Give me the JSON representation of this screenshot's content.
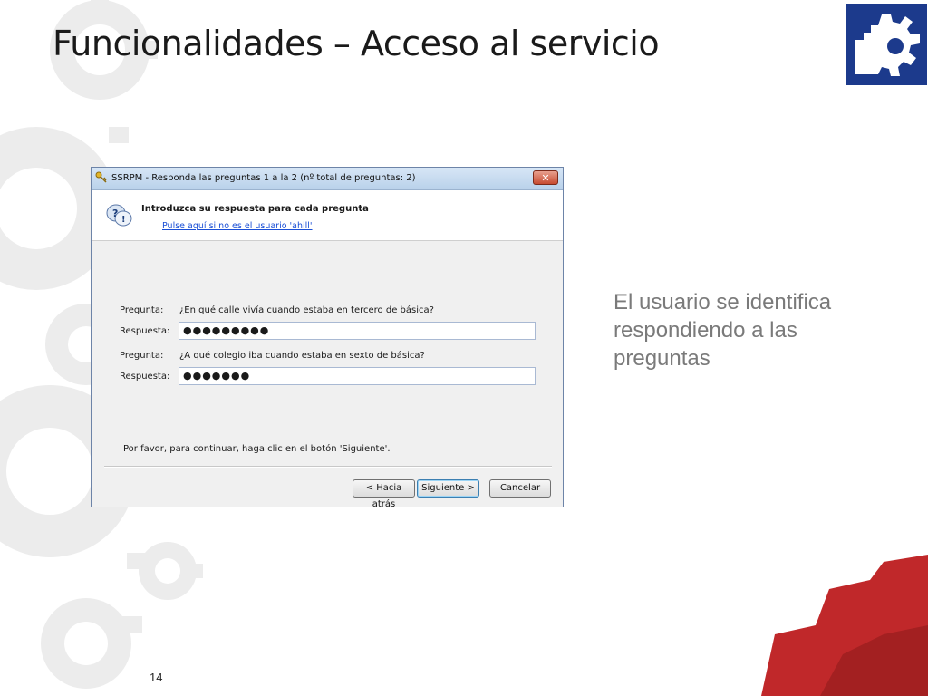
{
  "slide": {
    "title": "Funcionalidades – Acceso al servicio",
    "side_text": "El usuario se identifica respondiendo a las preguntas",
    "page_number": "14"
  },
  "dialog": {
    "title": "SSRPM - Responda las preguntas 1 a la 2 (nº total de preguntas: 2)",
    "close_label": "✕",
    "header_title": "Introduzca su respuesta para cada pregunta",
    "header_link": "Pulse aquí si no es el usuario 'ahill'",
    "questions": [
      {
        "question_label": "Pregunta:",
        "question_text": "¿En qué calle vivía cuando estaba en tercero de básica?",
        "answer_label": "Respuesta:",
        "answer_value": "●●●●●●●●●"
      },
      {
        "question_label": "Pregunta:",
        "question_text": "¿A qué colegio iba cuando estaba en sexto de básica?",
        "answer_label": "Respuesta:",
        "answer_value": "●●●●●●●"
      }
    ],
    "footer_text": "Por favor, para continuar, haga clic en el botón 'Siguiente'.",
    "buttons": {
      "back": "< Hacia atrás",
      "next": "Siguiente >",
      "cancel": "Cancelar"
    }
  },
  "colors": {
    "logo_blue": "#1c3a8c",
    "gear_red": "#c0282a",
    "gear_gray": "#e6e6e6"
  }
}
